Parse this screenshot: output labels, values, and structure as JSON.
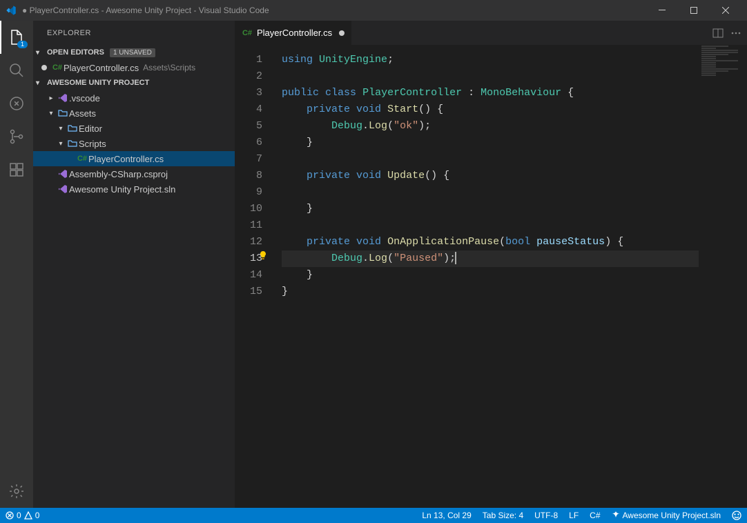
{
  "window": {
    "title": "● PlayerController.cs - Awesome Unity Project - Visual Studio Code"
  },
  "activitybar": {
    "explorer_badge": "1"
  },
  "sidebar": {
    "title": "Explorer",
    "open_editors": {
      "label": "Open Editors",
      "unsaved_badge": "1 UNSAVED",
      "items": [
        {
          "label": "PlayerController.cs",
          "path": "Assets\\Scripts",
          "dirty": true
        }
      ]
    },
    "project": {
      "label": "Awesome Unity Project",
      "tree": [
        {
          "depth": 1,
          "kind": "folder-closed",
          "label": ".vscode",
          "icon": "vs"
        },
        {
          "depth": 1,
          "kind": "folder-open",
          "label": "Assets",
          "icon": "folder"
        },
        {
          "depth": 2,
          "kind": "folder-open",
          "label": "Editor",
          "icon": "folder"
        },
        {
          "depth": 2,
          "kind": "folder-open",
          "label": "Scripts",
          "icon": "folder"
        },
        {
          "depth": 3,
          "kind": "file",
          "label": "PlayerController.cs",
          "icon": "csharp",
          "active": true
        },
        {
          "depth": 1,
          "kind": "file",
          "label": "Assembly-CSharp.csproj",
          "icon": "vs"
        },
        {
          "depth": 1,
          "kind": "file",
          "label": "Awesome Unity Project.sln",
          "icon": "vs"
        }
      ]
    }
  },
  "tabs": {
    "active": {
      "label": "PlayerController.cs",
      "dirty": true
    }
  },
  "code": {
    "lines": [
      [
        [
          "kw",
          "using"
        ],
        [
          "pl",
          " "
        ],
        [
          "type",
          "UnityEngine"
        ],
        [
          "pl",
          ";"
        ]
      ],
      [],
      [
        [
          "kw",
          "public"
        ],
        [
          "pl",
          " "
        ],
        [
          "kw",
          "class"
        ],
        [
          "pl",
          " "
        ],
        [
          "type",
          "PlayerController"
        ],
        [
          "pl",
          " : "
        ],
        [
          "type",
          "MonoBehaviour"
        ],
        [
          "pl",
          " {"
        ]
      ],
      [
        [
          "pl",
          "    "
        ],
        [
          "kw",
          "private"
        ],
        [
          "pl",
          " "
        ],
        [
          "kw",
          "void"
        ],
        [
          "pl",
          " "
        ],
        [
          "fn",
          "Start"
        ],
        [
          "pl",
          "() {"
        ]
      ],
      [
        [
          "pl",
          "        "
        ],
        [
          "type",
          "Debug"
        ],
        [
          "pl",
          "."
        ],
        [
          "fn",
          "Log"
        ],
        [
          "pl",
          "("
        ],
        [
          "str",
          "\"ok\""
        ],
        [
          "pl",
          ");"
        ]
      ],
      [
        [
          "pl",
          "    }"
        ]
      ],
      [],
      [
        [
          "pl",
          "    "
        ],
        [
          "kw",
          "private"
        ],
        [
          "pl",
          " "
        ],
        [
          "kw",
          "void"
        ],
        [
          "pl",
          " "
        ],
        [
          "fn",
          "Update"
        ],
        [
          "pl",
          "() {"
        ]
      ],
      [],
      [
        [
          "pl",
          "    }"
        ]
      ],
      [],
      [
        [
          "pl",
          "    "
        ],
        [
          "kw",
          "private"
        ],
        [
          "pl",
          " "
        ],
        [
          "kw",
          "void"
        ],
        [
          "pl",
          " "
        ],
        [
          "fn",
          "OnApplicationPause"
        ],
        [
          "pl",
          "("
        ],
        [
          "kw",
          "bool"
        ],
        [
          "pl",
          " "
        ],
        [
          "var",
          "pauseStatus"
        ],
        [
          "pl",
          ") {"
        ]
      ],
      [
        [
          "pl",
          "        "
        ],
        [
          "type",
          "Debug"
        ],
        [
          "pl",
          "."
        ],
        [
          "fn",
          "Log"
        ],
        [
          "pl",
          "("
        ],
        [
          "str",
          "\"Paused\""
        ],
        [
          "pl",
          ");"
        ]
      ],
      [
        [
          "pl",
          "    }"
        ]
      ],
      [
        [
          "pl",
          "}"
        ]
      ]
    ],
    "current_line": 13,
    "lightbulb_line": 13
  },
  "statusbar": {
    "errors": "0",
    "warnings": "0",
    "position": "Ln 13, Col 29",
    "tabsize": "Tab Size: 4",
    "encoding": "UTF-8",
    "eol": "LF",
    "language": "C#",
    "solution": "Awesome Unity Project.sln"
  }
}
